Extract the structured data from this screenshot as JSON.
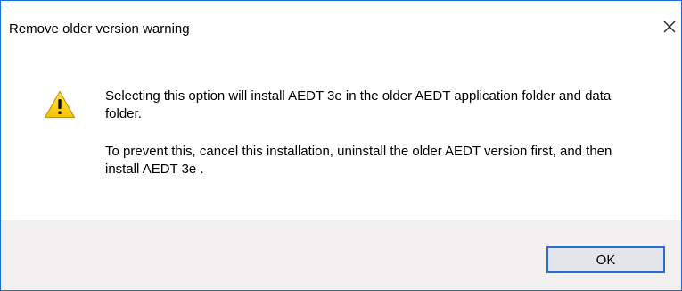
{
  "window": {
    "title": "Remove older version warning",
    "close_icon": "close-icon",
    "accent_color": "#1a6fd0"
  },
  "message": {
    "icon": "warning-icon",
    "paragraphs": [
      "Selecting this option will install AEDT 3e in the older AEDT application folder and data folder.",
      "To prevent this, cancel this installation, uninstall the older AEDT version first, and then install AEDT 3e ."
    ]
  },
  "footer": {
    "ok_label": "OK"
  }
}
